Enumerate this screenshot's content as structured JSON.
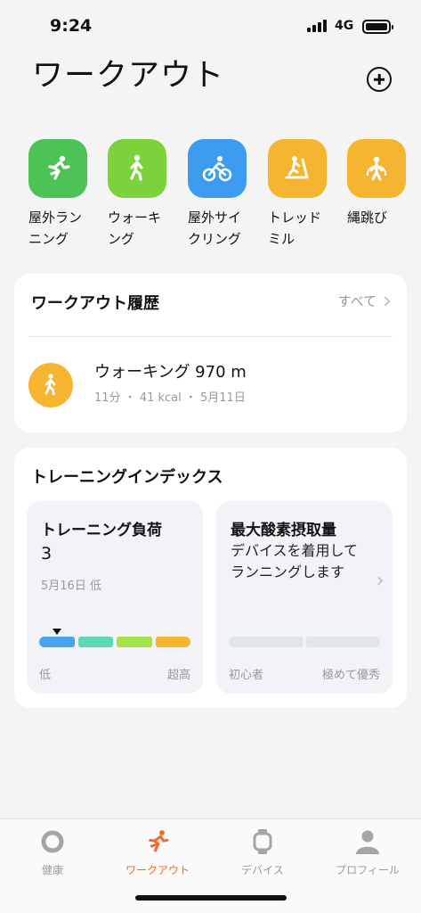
{
  "status_bar": {
    "time": "9:24",
    "network": "4G"
  },
  "header": {
    "title": "ワークアウト",
    "add_icon": "plus-circle-icon"
  },
  "workout_types": [
    {
      "label": "屋外ラン\nニング",
      "icon": "running-icon",
      "color": "#4cc257"
    },
    {
      "label": "ウォーキ\nング",
      "icon": "walking-icon",
      "color": "#7bd23a"
    },
    {
      "label": "屋外サイ\nクリング",
      "icon": "cycling-icon",
      "color": "#3d9bf0"
    },
    {
      "label": "トレッド\nミル",
      "icon": "treadmill-icon",
      "color": "#f5b531"
    },
    {
      "label": "縄跳び",
      "icon": "jump-rope-icon",
      "color": "#f5b531"
    }
  ],
  "history": {
    "title": "ワークアウト履歴",
    "see_all": "すべて",
    "item": {
      "icon": "walking-icon",
      "title": "ウォーキング 970 m",
      "subtitle": "11分 ・ 41 kcal ・ 5月11日"
    }
  },
  "training_index": {
    "title": "トレーニングインデックス",
    "load": {
      "title": "トレーニング負荷",
      "value": "3",
      "date": "5月16日 低",
      "scale_low": "低",
      "scale_high": "超高",
      "level_fraction": 0.12,
      "segment_colors": [
        "#4aa3f0",
        "#5ed6b8",
        "#a6e04a",
        "#f5b531"
      ]
    },
    "vo2": {
      "title": "最大酸素摂取量",
      "description": "デバイスを着用してランニングします",
      "scale_low": "初心者",
      "scale_high": "極めて優秀"
    }
  },
  "tabs": [
    {
      "label": "健康",
      "icon": "health-ring-icon",
      "active": false
    },
    {
      "label": "ワークアウト",
      "icon": "running-icon",
      "active": true
    },
    {
      "label": "デバイス",
      "icon": "watch-icon",
      "active": false
    },
    {
      "label": "プロフィール",
      "icon": "person-icon",
      "active": false
    }
  ],
  "colors": {
    "accent": "#ef6a2e",
    "background": "#f4f4f4"
  }
}
